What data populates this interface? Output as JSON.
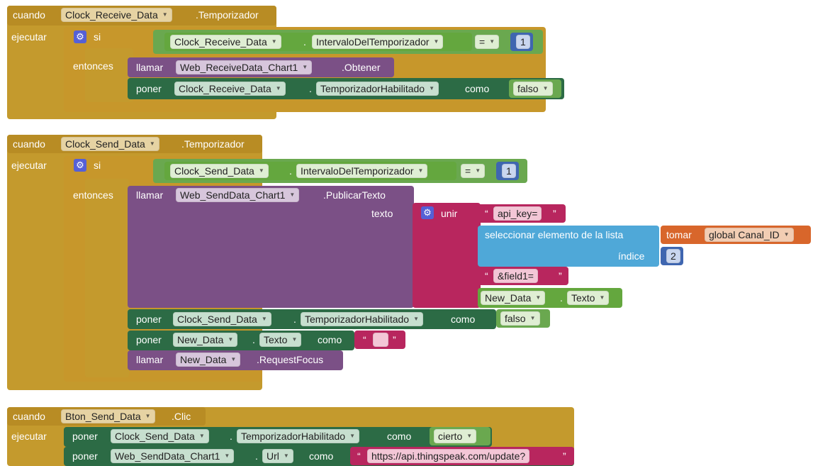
{
  "event1": {
    "when": "cuando",
    "component": "Clock_Receive_Data",
    "event": ".Temporizador",
    "do": "ejecutar",
    "if_label": "si",
    "then_label": "entonces",
    "cond_component": "Clock_Receive_Data",
    "cond_dot": ".",
    "cond_property": "IntervaloDelTemporizador",
    "cond_op": "=",
    "cond_value": "1",
    "call_label": "llamar",
    "call_component": "Web_ReceiveData_Chart1",
    "call_method": ".Obtener",
    "set_label": "poner",
    "set_component": "Clock_Receive_Data",
    "set_dot": ".",
    "set_property": "TemporizadorHabilitado",
    "set_to": "como",
    "set_value": "falso"
  },
  "event2": {
    "when": "cuando",
    "component": "Clock_Send_Data",
    "event": ".Temporizador",
    "do": "ejecutar",
    "if_label": "si",
    "then_label": "entonces",
    "cond_component": "Clock_Send_Data",
    "cond_dot": ".",
    "cond_property": "IntervaloDelTemporizador",
    "cond_op": "=",
    "cond_value": "1",
    "call_label": "llamar",
    "call_component": "Web_SendData_Chart1",
    "call_method": ".PublicarTexto",
    "text_param": "texto",
    "join_label": "unir",
    "str1": "api_key=",
    "select_label": "seleccionar elemento de la lista",
    "get_label": "tomar",
    "get_var": "global Canal_ID",
    "index_label": "índice",
    "index_value": "2",
    "str2": "&field1=",
    "txt_component": "New_Data",
    "txt_dot": ".",
    "txt_property": "Texto",
    "set1_label": "poner",
    "set1_component": "Clock_Send_Data",
    "set1_dot": ".",
    "set1_property": "TemporizadorHabilitado",
    "set1_to": "como",
    "set1_value": "falso",
    "set2_label": "poner",
    "set2_component": "New_Data",
    "set2_dot": ".",
    "set2_property": "Texto",
    "set2_to": "como",
    "set2_value": "",
    "call2_label": "llamar",
    "call2_component": "New_Data",
    "call2_method": ".RequestFocus"
  },
  "event3": {
    "when": "cuando",
    "component": "Bton_Send_Data",
    "event": ".Clic",
    "do": "ejecutar",
    "set1_label": "poner",
    "set1_component": "Clock_Send_Data",
    "set1_dot": ".",
    "set1_property": "TemporizadorHabilitado",
    "set1_to": "como",
    "set1_value": "cierto",
    "set2_label": "poner",
    "set2_component": "Web_SendData_Chart1",
    "set2_dot": ".",
    "set2_property": "Url",
    "set2_to": "como",
    "set2_value": "https://api.thingspeak.com/update?"
  },
  "quote": "“",
  "quote_close": "”",
  "dropdown": "▼",
  "gear": "⚙"
}
